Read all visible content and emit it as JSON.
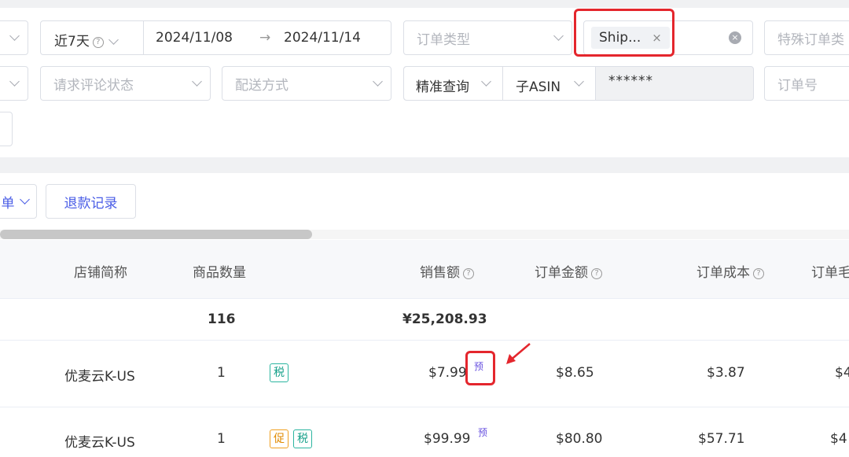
{
  "filters": {
    "date_range": {
      "preset": "近7天",
      "start": "2024/11/08",
      "arrow": "→",
      "end": "2024/11/14"
    },
    "order_type_placeholder": "订单类型",
    "selected_tag": "Ship...",
    "tag_close": "×",
    "clear_symbol": "×",
    "special_order_placeholder": "特殊订单类",
    "review_status_placeholder": "请求评论状态",
    "shipping_method_placeholder": "配送方式",
    "query_mode": "精准查询",
    "search_field": "子ASIN",
    "search_value": "******",
    "order_no_placeholder": "订单号"
  },
  "toolbar": {
    "dropdown_partial": "单",
    "refund_button": "退款记录"
  },
  "table": {
    "headers": {
      "store": "店铺简称",
      "quantity": "商品数量",
      "sales": "销售额",
      "order_amount": "订单金额",
      "order_cost": "订单成本",
      "order_margin": "订单毛"
    },
    "summary": {
      "quantity": "116",
      "sales": "¥25,208.93"
    },
    "rows": [
      {
        "store": "优麦云K-US",
        "quantity": "1",
        "badges": [
          "税"
        ],
        "sales": "$7.99",
        "pre": "预",
        "order_amount": "$8.65",
        "order_cost": "$3.87",
        "margin_partial": "$4"
      },
      {
        "store": "优麦云K-US",
        "quantity": "1",
        "badges": [
          "促",
          "税"
        ],
        "sales": "$99.99",
        "pre": "预",
        "order_amount": "$80.80",
        "order_cost": "$57.71",
        "margin_partial": "$4"
      }
    ]
  },
  "help_symbol": "?",
  "colors": {
    "accent": "#4a5de6",
    "highlight_red": "#e4262d",
    "tax_badge": "#16a08a",
    "promo_badge": "#e08a00",
    "pre_label": "#6b55e0"
  }
}
